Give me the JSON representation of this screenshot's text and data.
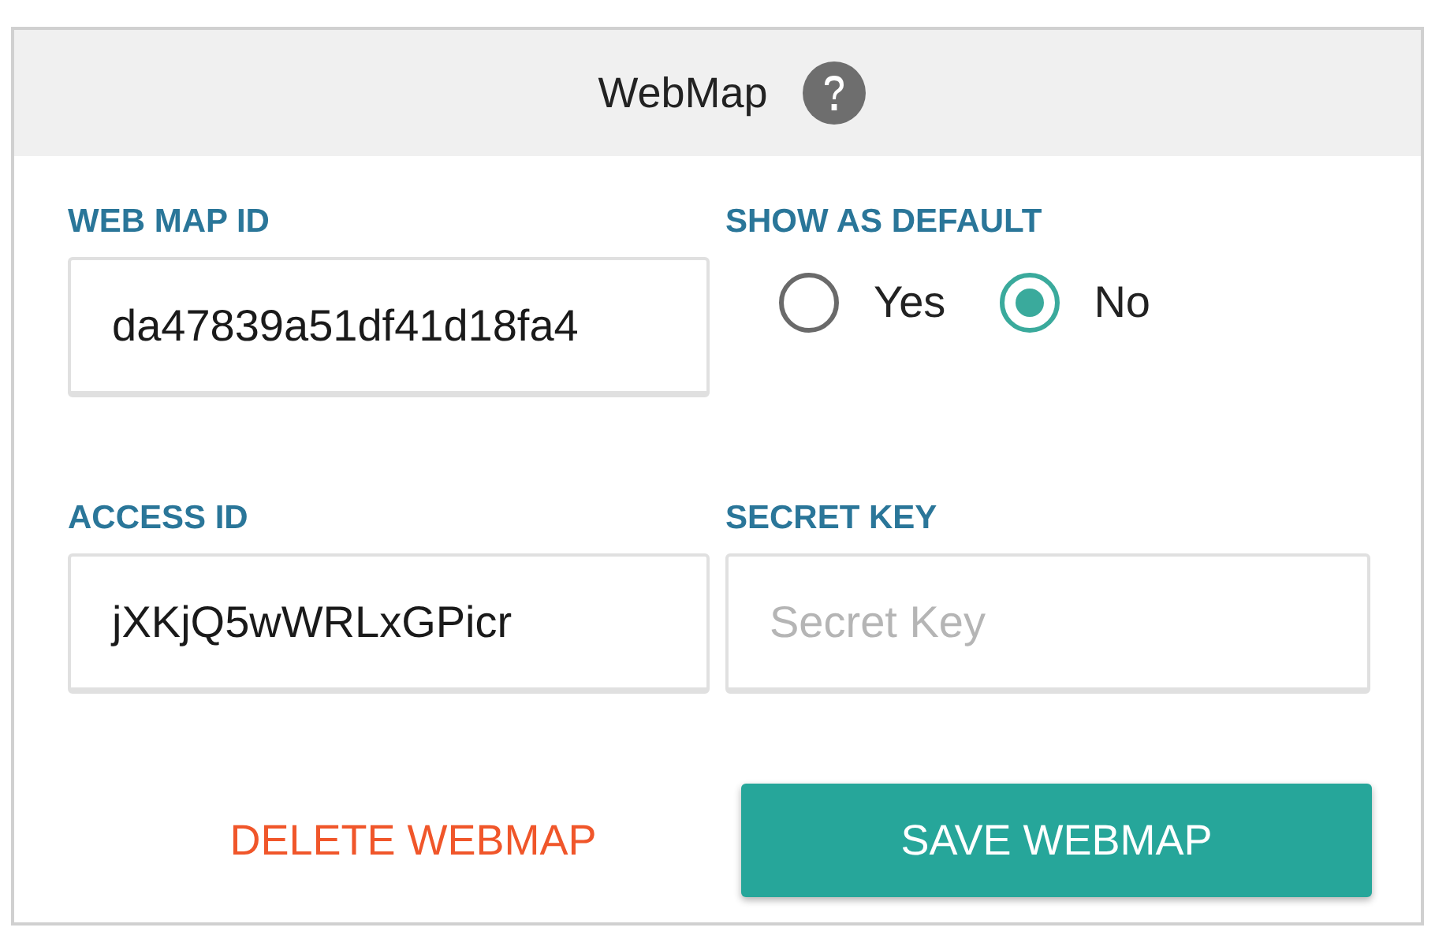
{
  "header": {
    "title": "WebMap"
  },
  "web_map_id": {
    "label": "WEB MAP ID",
    "value": "da47839a51df41d18fa4"
  },
  "show_as_default": {
    "label": "SHOW AS DEFAULT",
    "options": [
      {
        "label": "Yes",
        "selected": false
      },
      {
        "label": "No",
        "selected": true
      }
    ]
  },
  "access_id": {
    "label": "ACCESS ID",
    "value": "jXKjQ5wWRLxGPicr"
  },
  "secret_key": {
    "label": "SECRET KEY",
    "placeholder": "Secret Key"
  },
  "buttons": {
    "delete": "DELETE WEBMAP",
    "save": "SAVE WEBMAP"
  }
}
